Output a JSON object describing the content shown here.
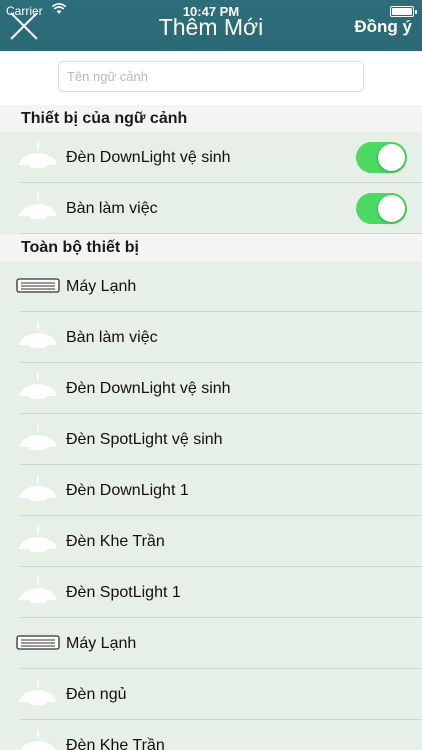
{
  "status": {
    "carrier": "Carrier",
    "time": "10:47 PM"
  },
  "header": {
    "title": "Thêm Mới",
    "done_label": "Đồng ý"
  },
  "name_input": {
    "placeholder": "Tên ngữ cảnh",
    "value": ""
  },
  "context_devices": {
    "title": "Thiết bị của ngữ cảnh",
    "items": [
      {
        "label": "Đèn DownLight vệ sinh",
        "icon": "lamp-icon",
        "enabled": true
      },
      {
        "label": "Bàn làm việc",
        "icon": "lamp-icon",
        "enabled": true
      }
    ]
  },
  "all_devices": {
    "title": "Toàn bộ thiết bị",
    "items": [
      {
        "label": "Máy Lạnh",
        "icon": "air-conditioner-icon"
      },
      {
        "label": "Bàn làm việc",
        "icon": "lamp-icon"
      },
      {
        "label": "Đèn DownLight vệ sinh",
        "icon": "lamp-icon"
      },
      {
        "label": "Đèn SpotLight vệ sinh",
        "icon": "lamp-icon"
      },
      {
        "label": "Đèn DownLight 1",
        "icon": "lamp-icon"
      },
      {
        "label": "Đèn Khe Trần",
        "icon": "lamp-icon"
      },
      {
        "label": "Đèn SpotLight 1",
        "icon": "lamp-icon"
      },
      {
        "label": "Máy Lạnh",
        "icon": "air-conditioner-icon"
      },
      {
        "label": "Đèn ngủ",
        "icon": "lamp-icon"
      },
      {
        "label": "Đèn Khe Trần",
        "icon": "lamp-icon"
      }
    ]
  },
  "colors": {
    "header": "#2a6975",
    "row_bg": "#e6f0e6",
    "toggle_on": "#4cd964"
  }
}
